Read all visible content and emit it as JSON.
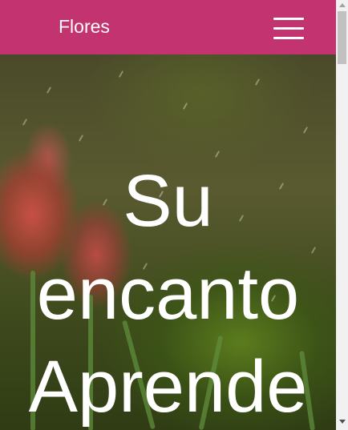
{
  "navbar": {
    "brand": "Flores",
    "menu_icon": "hamburger-menu-icon",
    "background_color": "#c2336f"
  },
  "hero": {
    "title_lines": [
      "Su",
      "encanto",
      "Aprende"
    ],
    "background": "tulips-in-rain-photo"
  },
  "scrollbar": {
    "up_icon": "scroll-up-arrow-icon",
    "down_icon": "scroll-down-arrow-icon"
  }
}
